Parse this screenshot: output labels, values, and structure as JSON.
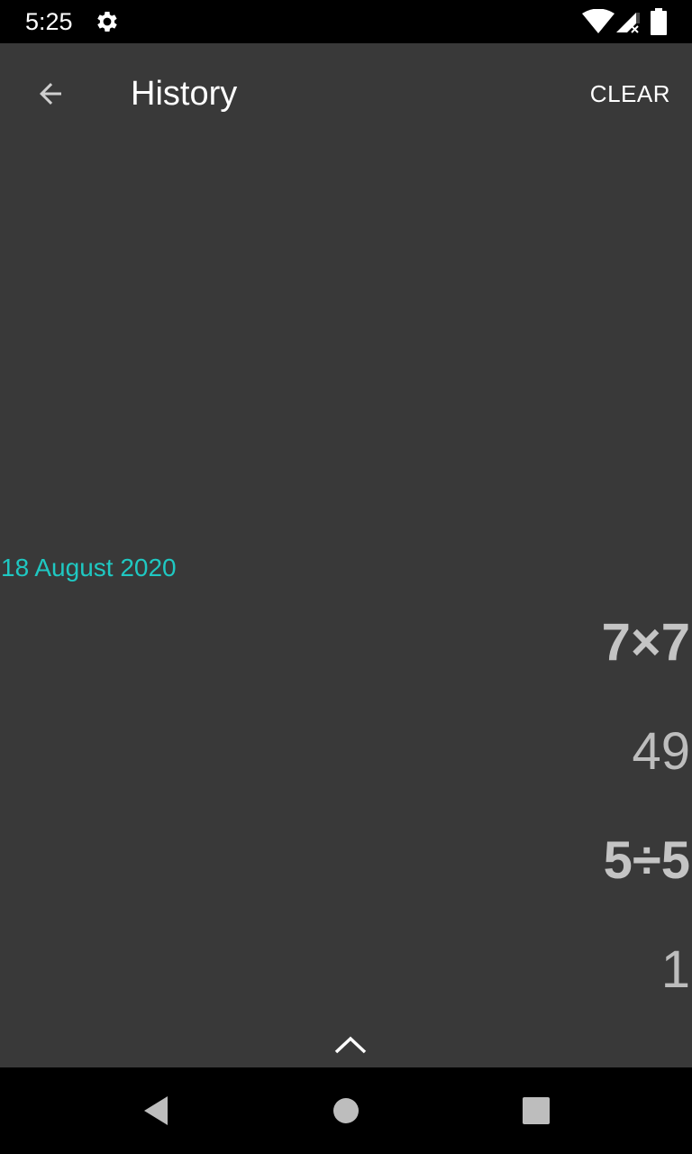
{
  "status_bar": {
    "time": "5:25",
    "icons": [
      "gear-icon",
      "wifi-icon",
      "signal-icon",
      "battery-icon"
    ]
  },
  "app_bar": {
    "back_icon": "arrow-left-icon",
    "title": "History",
    "clear_label": "CLEAR"
  },
  "history": {
    "date": "18 August 2020",
    "entries": [
      {
        "expression": "7×7",
        "result": "49"
      },
      {
        "expression": "5÷5",
        "result": "1"
      }
    ]
  },
  "collapse_icon": "chevron-up-icon",
  "nav_bar": {
    "icons": [
      "back-triangle-icon",
      "home-circle-icon",
      "recents-square-icon"
    ]
  },
  "colors": {
    "background": "#393939",
    "accent": "#1fc8c2",
    "bars": "#000000"
  }
}
